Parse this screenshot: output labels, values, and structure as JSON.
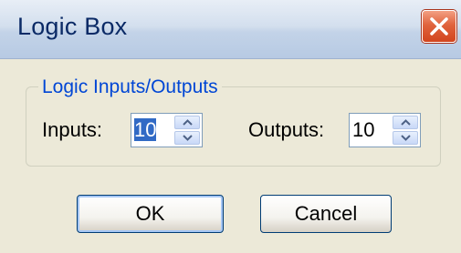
{
  "window": {
    "title": "Logic Box"
  },
  "group": {
    "legend": "Logic Inputs/Outputs"
  },
  "inputs": {
    "label": "Inputs:",
    "value": "10"
  },
  "outputs": {
    "label": "Outputs:",
    "value": "10"
  },
  "buttons": {
    "ok": "OK",
    "cancel": "Cancel"
  },
  "colors": {
    "legend": "#0046D5",
    "selection": "#316AC5",
    "close_button": "#D2451E"
  },
  "icons": {
    "close": "close-x-icon",
    "spin_up": "arrow-up-icon",
    "spin_down": "arrow-down-icon"
  }
}
